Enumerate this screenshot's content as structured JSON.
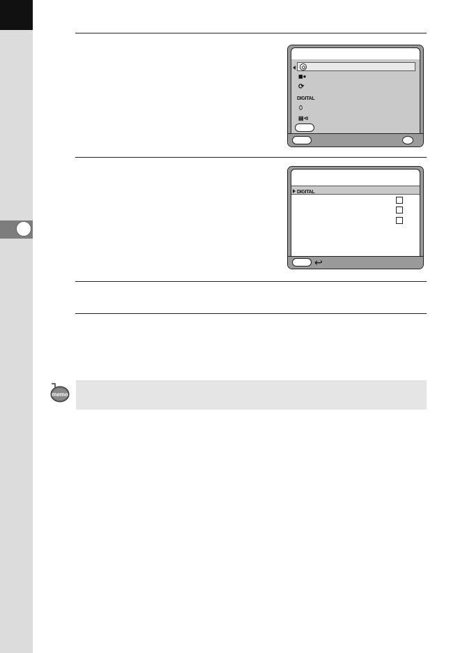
{
  "page": {
    "margin_tab": {
      "icon": "chapter-marker-circle"
    }
  },
  "screen1": {
    "menu_icons": [
      "aperture-circle-icon",
      "black-white-filter-icon",
      "rotate-icon",
      "digital-filter-icon",
      "shield-icon",
      "movie-edit-icon"
    ],
    "selected_index": 0
  },
  "screen2": {
    "header_label": "DIGITAL",
    "checkbox_count": 3
  },
  "memo": {
    "icon": "memo-icon",
    "text": ""
  },
  "colors": {
    "side_strip": "#dcdcdc",
    "screen_frame": "#9a9a9a",
    "memo_background": "#e5e5e5"
  }
}
